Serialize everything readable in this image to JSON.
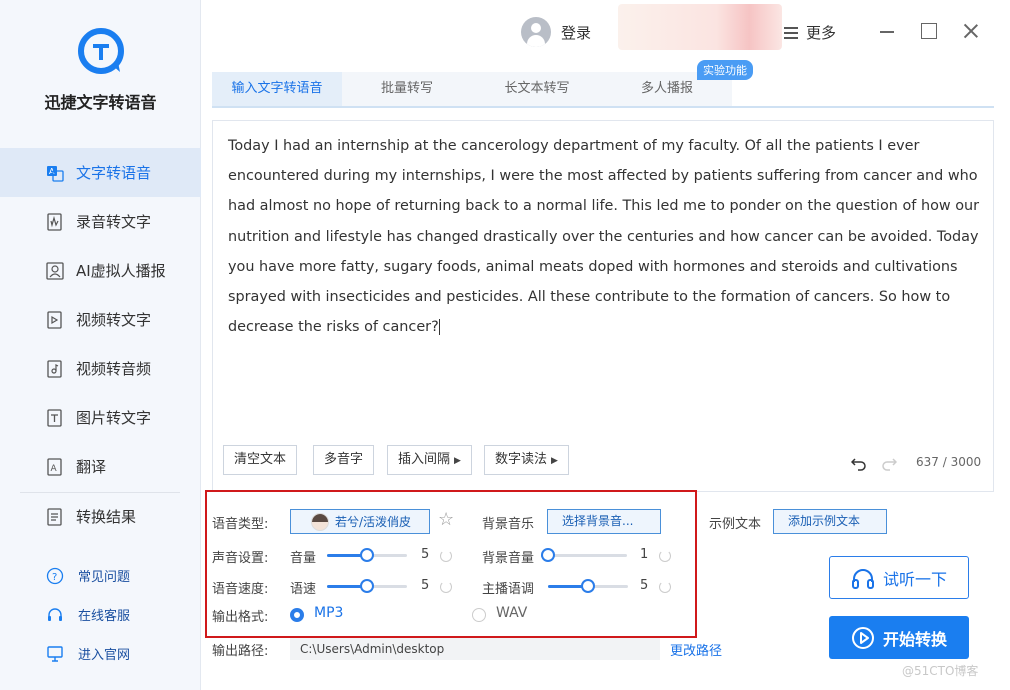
{
  "app": {
    "name": "迅捷文字转语音"
  },
  "sidebar": {
    "items": [
      {
        "label": "文字转语音",
        "active": true
      },
      {
        "label": "录音转文字"
      },
      {
        "label": "AI虚拟人播报"
      },
      {
        "label": "视频转文字"
      },
      {
        "label": "视频转音频"
      },
      {
        "label": "图片转文字"
      },
      {
        "label": "翻译"
      }
    ],
    "result": "转换结果",
    "links": [
      {
        "label": "常见问题",
        "icon": "question-icon"
      },
      {
        "label": "在线客服",
        "icon": "headset-icon"
      },
      {
        "label": "进入官网",
        "icon": "monitor-icon"
      }
    ]
  },
  "header": {
    "login": "登录",
    "more": "更多"
  },
  "tabs": [
    {
      "label": "输入文字转语音",
      "active": true
    },
    {
      "label": "批量转写"
    },
    {
      "label": "长文本转写"
    },
    {
      "label": "多人播报"
    }
  ],
  "badge": "实验功能",
  "editor": {
    "text": "Today I had an internship at the cancerology department of my faculty. Of all the patients I ever encountered during my internships, I were the most affected by patients suffering from cancer and who had almost no hope of returning back to a normal life. This led me to ponder on the question of how our nutrition and lifestyle has changed drastically over the centuries and how cancer can be avoided. Today you have more fatty, sugary foods, animal meats doped with hormones and steroids and cultivations sprayed with insecticides and pesticides. All these contribute to the formation of cancers. So how to decrease the risks of cancer?",
    "buttons": {
      "clear": "清空文本",
      "polyphone": "多音字",
      "insert_pause": "插入间隔",
      "number_reading": "数字读法"
    },
    "counter": "637 / 3000"
  },
  "settings": {
    "voice_type_label": "语音类型:",
    "voice_name": "若兮/活泼俏皮",
    "bg_music_label": "背景音乐",
    "bg_music_button": "选择背景音...",
    "sample_label": "示例文本",
    "sample_button": "添加示例文本",
    "sound_label": "声音设置:",
    "volume_label": "音量",
    "volume_value": "5",
    "volume_fraction": 0.5,
    "bg_volume_label": "背景音量",
    "bg_volume_value": "1",
    "bg_volume_fraction": 0.0,
    "speed_label": "语音速度:",
    "speed_sub_label": "语速",
    "speed_value": "5",
    "speed_fraction": 0.5,
    "pitch_label": "主播语调",
    "pitch_value": "5",
    "pitch_fraction": 0.5,
    "format_label": "输出格式:",
    "format_options": [
      "MP3",
      "WAV"
    ],
    "format_selected": "MP3",
    "path_label": "输出路径:",
    "path_value": "C:\\Users\\Admin\\desktop",
    "path_change": "更改路径"
  },
  "actions": {
    "preview": "试听一下",
    "start": "开始转换"
  },
  "watermark": "@51CTO博客",
  "colors": {
    "accent": "#1a7ef0",
    "highlight_border": "#d0191b"
  }
}
